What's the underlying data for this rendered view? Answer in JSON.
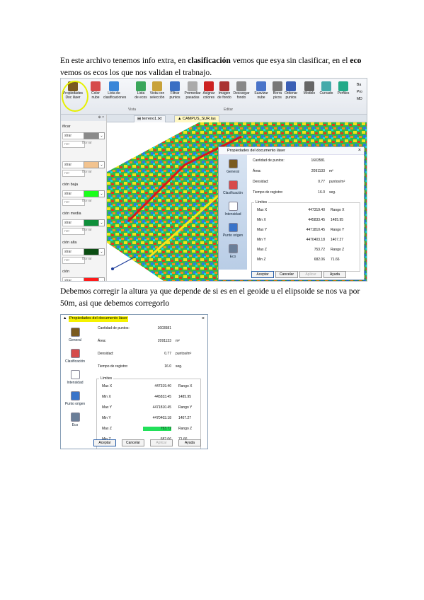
{
  "text": {
    "p1_pre": "En este archivo tenemos info extra, en ",
    "p1_b1": "clasificación",
    "p1_mid": " vemos que esya sin clasificar, en el ",
    "p1_b2": "eco",
    "p1_post": " vemos os ecos los que nos validan el trabnajo.",
    "p2": "Debemos corregir la altura ya que depende de si es en el geoide u el elipsoide se nos va por 50m, asi que debemos corregorlo"
  },
  "ribbon": {
    "buttons": [
      {
        "label": "Propiedades\nDoc láser",
        "icon": "las-properties-icon"
      },
      {
        "label": "Color\nnube",
        "icon": "color-cloud-icon"
      },
      {
        "label": "Lista de\nclasificaciones",
        "icon": "class-list-icon"
      },
      {
        "label": "Lista\nde ecos",
        "icon": "echo-list-icon"
      },
      {
        "label": "Vista con\nselección",
        "icon": "selection-view-icon"
      },
      {
        "label": "Filtrar\npuntos",
        "icon": "filter-icon"
      },
      {
        "label": "Promediar\npasadas",
        "icon": "average-icon"
      },
      {
        "label": "Asignar\ncolores",
        "icon": "assign-colors-icon"
      },
      {
        "label": "Imagen\nde fondo",
        "icon": "background-image-icon"
      },
      {
        "label": "Descargar\nfondo",
        "icon": "download-icon"
      },
      {
        "label": "Suavizar\nnube",
        "icon": "smooth-icon"
      },
      {
        "label": "Borra\npicos",
        "icon": "erase-peaks-icon"
      },
      {
        "label": "Ordenar\npuntos",
        "icon": "sort-icon"
      },
      {
        "label": "Modelo",
        "icon": "model-icon"
      },
      {
        "label": "Curvado",
        "icon": "contours-icon"
      },
      {
        "label": "Perfiles",
        "icon": "profiles-icon"
      }
    ],
    "groups": [
      "Vista",
      "Editar"
    ],
    "side_items": [
      "Ba",
      "Pro",
      "MD"
    ]
  },
  "left_panel": {
    "pin": "⊕ ×",
    "rows": [
      {
        "label": "ificar",
        "mode": "strar",
        "color": "#8a8a8a"
      },
      {
        "label": "",
        "mode": "strar",
        "color": "#f2c38f"
      },
      {
        "label": "ción baja",
        "mode": "strar",
        "color": "#1aff1a"
      },
      {
        "label": "ción media",
        "mode": "strar",
        "color": "#0e8f3a"
      },
      {
        "label": "ción alta",
        "mode": "strar",
        "color": "#0b4d12"
      },
      {
        "label": "ción",
        "mode": "strar",
        "color": "#ff1a1a"
      }
    ],
    "mode_second": "ner",
    "erase_label": "Borrar"
  },
  "tabs": [
    {
      "label": "terreno1.txt"
    },
    {
      "label": "CAMPUS_SUR.las"
    }
  ],
  "dialog1": {
    "title": "Propiedades del documento láser",
    "close": "×",
    "side": [
      "General",
      "Clasificación",
      "Intensidad",
      "Punto origen",
      "Eco"
    ],
    "fields": [
      {
        "label": "Cantidad de puntos:",
        "value": "1603581",
        "unit": ""
      },
      {
        "label": "Área:",
        "value": "2091133",
        "unit": "m²"
      },
      {
        "label": "Densidad:",
        "value": "0.77",
        "unit": "puntos/m²"
      },
      {
        "label": "Tiempo de registro:",
        "value": "16.0",
        "unit": "seg."
      }
    ],
    "limits_title": "Límites",
    "limits": [
      {
        "label": "Max X",
        "value": "447319.40",
        "rlabel": "Rango X",
        "rvalue": ""
      },
      {
        "label": "Min X",
        "value": "445833.45",
        "rlabel": "",
        "rvalue": "1485.95"
      },
      {
        "label": "Max Y",
        "value": "4471810.45",
        "rlabel": "Rango Y",
        "rvalue": ""
      },
      {
        "label": "Min Y",
        "value": "4470403.18",
        "rlabel": "",
        "rvalue": "1407.27"
      },
      {
        "label": "Max Z",
        "value": "753.72",
        "rlabel": "Rango Z",
        "rvalue": ""
      },
      {
        "label": "Min Z",
        "value": "682.06",
        "rlabel": "",
        "rvalue": "71.66"
      }
    ],
    "buttons": [
      "Aceptar",
      "Cancelar",
      "Aplicar",
      "Ayuda"
    ]
  },
  "dialog2": {
    "title": "Propiedades del documento láser",
    "close": "×",
    "side": [
      "General",
      "Clasificación",
      "Intensidad",
      "Punto origen",
      "Eco"
    ],
    "fields": [
      {
        "label": "Cantidad de puntos:",
        "value": "1603581",
        "unit": ""
      },
      {
        "label": "Área:",
        "value": "2091133",
        "unit": "m²"
      },
      {
        "label": "Densidad:",
        "value": "0.77",
        "unit": "puntos/m²"
      },
      {
        "label": "Tiempo de registro:",
        "value": "16.0",
        "unit": "seg."
      }
    ],
    "limits_title": "Límites",
    "limits": [
      {
        "label": "Max X",
        "value": "447319.40",
        "rlabel": "Rango X",
        "rvalue": ""
      },
      {
        "label": "Min X",
        "value": "445833.45",
        "rlabel": "",
        "rvalue": "1485.95"
      },
      {
        "label": "Max Y",
        "value": "4471810.45",
        "rlabel": "Rango Y",
        "rvalue": ""
      },
      {
        "label": "Min Y",
        "value": "4470403.18",
        "rlabel": "",
        "rvalue": "1407.27"
      },
      {
        "label": "Max Z",
        "value": "753.72",
        "rlabel": "Rango Z",
        "rvalue": ""
      },
      {
        "label": "Min Z",
        "value": "682.06",
        "rlabel": "",
        "rvalue": "71.66"
      }
    ],
    "buttons": [
      "Aceptar",
      "Cancelar",
      "Aplicar",
      "Ayuda"
    ],
    "highlight_color": "#22e05a"
  },
  "colors": {
    "highlight": "#e6f000",
    "accent": "#2a5fa8"
  }
}
